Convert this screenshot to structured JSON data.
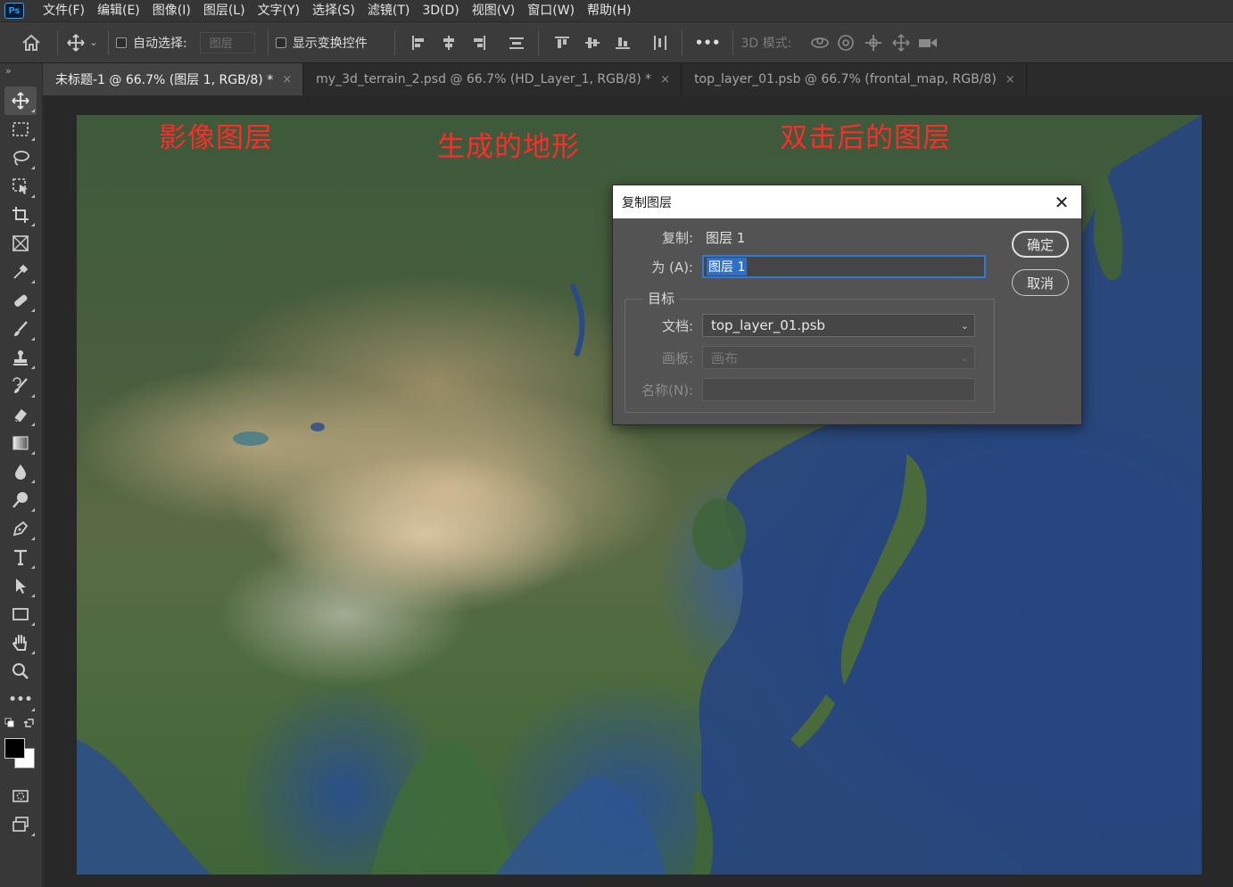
{
  "menubar": {
    "logo": "Ps",
    "items": [
      "文件(F)",
      "编辑(E)",
      "图像(I)",
      "图层(L)",
      "文字(Y)",
      "选择(S)",
      "滤镜(T)",
      "3D(D)",
      "视图(V)",
      "窗口(W)",
      "帮助(H)"
    ]
  },
  "options": {
    "auto_select_label": "自动选择:",
    "auto_select_value": "图层",
    "show_transform_label": "显示变换控件",
    "more_label": "•••",
    "mode_3d_label": "3D 模式:"
  },
  "tabs": [
    {
      "label": "未标题-1 @ 66.7% (图层 1, RGB/8) *",
      "active": true
    },
    {
      "label": "my_3d_terrain_2.psd @ 66.7% (HD_Layer_1, RGB/8) *",
      "active": false
    },
    {
      "label": "top_layer_01.psb @ 66.7% (frontal_map, RGB/8)",
      "active": false
    }
  ],
  "tab_close_glyph": "×",
  "canvas": {
    "labels": [
      "影像图层",
      "生成的地形",
      "双击后的图层"
    ],
    "label_color": "#ff2a2a"
  },
  "dialog": {
    "title": "复制图层",
    "close_glyph": "✕",
    "duplicate_label": "复制:",
    "duplicate_value": "图层 1",
    "as_label": "为 (A):",
    "as_value": "图层 1",
    "target_legend": "目标",
    "document_label": "文档:",
    "document_value": "top_layer_01.psb",
    "artboard_label": "画板:",
    "artboard_value": "画布",
    "name_label": "名称(N):",
    "name_value": "",
    "ok_label": "确定",
    "cancel_label": "取消"
  },
  "colors": {
    "accent_blue": "#2d7bd6",
    "foreground_swatch": "#000000",
    "background_swatch": "#ffffff"
  }
}
